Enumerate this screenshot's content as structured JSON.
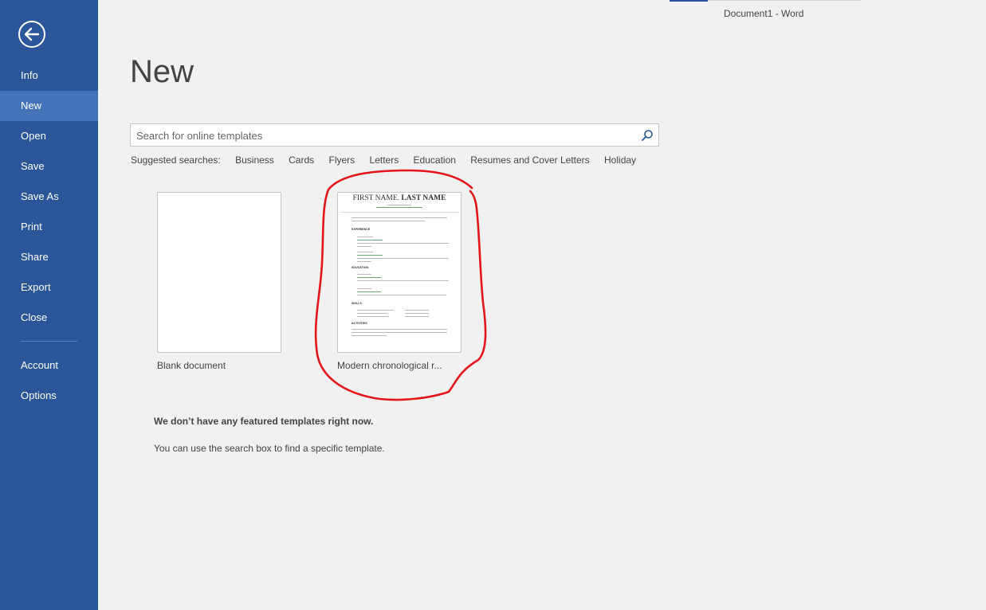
{
  "window": {
    "title": "Document1 - Word"
  },
  "sidebar": {
    "back_icon": "arrow-left-circle-icon",
    "items": [
      {
        "label": "Info"
      },
      {
        "label": "New",
        "active": true
      },
      {
        "label": "Open"
      },
      {
        "label": "Save"
      },
      {
        "label": "Save As"
      },
      {
        "label": "Print"
      },
      {
        "label": "Share"
      },
      {
        "label": "Export"
      },
      {
        "label": "Close"
      },
      {
        "label": "Account"
      },
      {
        "label": "Options"
      }
    ]
  },
  "main": {
    "title": "New",
    "search": {
      "placeholder": "Search for online templates",
      "value": "",
      "icon": "search-icon"
    },
    "suggested": {
      "label": "Suggested searches:",
      "items": [
        "Business",
        "Cards",
        "Flyers",
        "Letters",
        "Education",
        "Resumes and Cover Letters",
        "Holiday"
      ]
    },
    "templates": [
      {
        "label": "Blank document"
      },
      {
        "label": "Modern chronological r...",
        "thumbnail": {
          "name_first": "FIRST NAME",
          "name_last": "LAST NAME",
          "headings": [
            "EXPERIENCE",
            "EDUCATION",
            "SKILLS",
            "ACTIVITIES"
          ]
        }
      }
    ],
    "no_featured": "We don’t have any featured templates right now.",
    "hint": "You can use the search box to find a specific template."
  },
  "colors": {
    "sidebar": "#2b579a",
    "sidebar_active": "#4473b8",
    "annotation": "#e3151a"
  }
}
